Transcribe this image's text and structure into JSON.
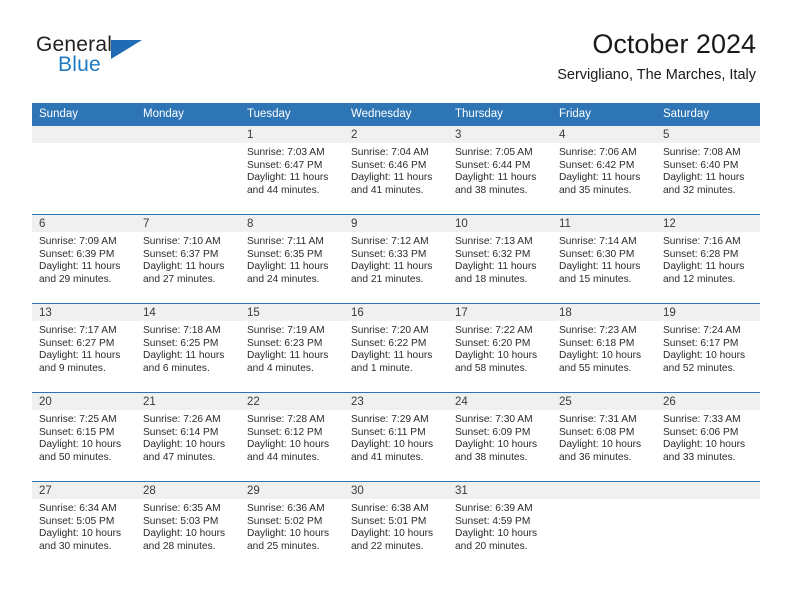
{
  "brand": {
    "name_part1": "General",
    "name_part2": "Blue",
    "logo_icon": "triangle-flag-icon"
  },
  "header": {
    "month_title": "October 2024",
    "location": "Servigliano, The Marches, Italy"
  },
  "theme": {
    "header_blue": "#2e75b6",
    "daynum_band": "#f0f0f0",
    "brand_blue": "#1f7ac4",
    "text": "#2b2b2b"
  },
  "weekday_headers": [
    "Sunday",
    "Monday",
    "Tuesday",
    "Wednesday",
    "Thursday",
    "Friday",
    "Saturday"
  ],
  "labels": {
    "sunrise_prefix": "Sunrise:",
    "sunset_prefix": "Sunset:",
    "daylight_prefix": "Daylight:"
  },
  "weeks": [
    [
      {
        "day": "",
        "empty": true,
        "sunrise": "",
        "sunset": "",
        "daylight_line1": "",
        "daylight_line2": ""
      },
      {
        "day": "",
        "empty": true,
        "sunrise": "",
        "sunset": "",
        "daylight_line1": "",
        "daylight_line2": ""
      },
      {
        "day": "1",
        "empty": false,
        "sunrise": "Sunrise: 7:03 AM",
        "sunset": "Sunset: 6:47 PM",
        "daylight_line1": "Daylight: 11 hours",
        "daylight_line2": "and 44 minutes."
      },
      {
        "day": "2",
        "empty": false,
        "sunrise": "Sunrise: 7:04 AM",
        "sunset": "Sunset: 6:46 PM",
        "daylight_line1": "Daylight: 11 hours",
        "daylight_line2": "and 41 minutes."
      },
      {
        "day": "3",
        "empty": false,
        "sunrise": "Sunrise: 7:05 AM",
        "sunset": "Sunset: 6:44 PM",
        "daylight_line1": "Daylight: 11 hours",
        "daylight_line2": "and 38 minutes."
      },
      {
        "day": "4",
        "empty": false,
        "sunrise": "Sunrise: 7:06 AM",
        "sunset": "Sunset: 6:42 PM",
        "daylight_line1": "Daylight: 11 hours",
        "daylight_line2": "and 35 minutes."
      },
      {
        "day": "5",
        "empty": false,
        "sunrise": "Sunrise: 7:08 AM",
        "sunset": "Sunset: 6:40 PM",
        "daylight_line1": "Daylight: 11 hours",
        "daylight_line2": "and 32 minutes."
      }
    ],
    [
      {
        "day": "6",
        "empty": false,
        "sunrise": "Sunrise: 7:09 AM",
        "sunset": "Sunset: 6:39 PM",
        "daylight_line1": "Daylight: 11 hours",
        "daylight_line2": "and 29 minutes."
      },
      {
        "day": "7",
        "empty": false,
        "sunrise": "Sunrise: 7:10 AM",
        "sunset": "Sunset: 6:37 PM",
        "daylight_line1": "Daylight: 11 hours",
        "daylight_line2": "and 27 minutes."
      },
      {
        "day": "8",
        "empty": false,
        "sunrise": "Sunrise: 7:11 AM",
        "sunset": "Sunset: 6:35 PM",
        "daylight_line1": "Daylight: 11 hours",
        "daylight_line2": "and 24 minutes."
      },
      {
        "day": "9",
        "empty": false,
        "sunrise": "Sunrise: 7:12 AM",
        "sunset": "Sunset: 6:33 PM",
        "daylight_line1": "Daylight: 11 hours",
        "daylight_line2": "and 21 minutes."
      },
      {
        "day": "10",
        "empty": false,
        "sunrise": "Sunrise: 7:13 AM",
        "sunset": "Sunset: 6:32 PM",
        "daylight_line1": "Daylight: 11 hours",
        "daylight_line2": "and 18 minutes."
      },
      {
        "day": "11",
        "empty": false,
        "sunrise": "Sunrise: 7:14 AM",
        "sunset": "Sunset: 6:30 PM",
        "daylight_line1": "Daylight: 11 hours",
        "daylight_line2": "and 15 minutes."
      },
      {
        "day": "12",
        "empty": false,
        "sunrise": "Sunrise: 7:16 AM",
        "sunset": "Sunset: 6:28 PM",
        "daylight_line1": "Daylight: 11 hours",
        "daylight_line2": "and 12 minutes."
      }
    ],
    [
      {
        "day": "13",
        "empty": false,
        "sunrise": "Sunrise: 7:17 AM",
        "sunset": "Sunset: 6:27 PM",
        "daylight_line1": "Daylight: 11 hours",
        "daylight_line2": "and 9 minutes."
      },
      {
        "day": "14",
        "empty": false,
        "sunrise": "Sunrise: 7:18 AM",
        "sunset": "Sunset: 6:25 PM",
        "daylight_line1": "Daylight: 11 hours",
        "daylight_line2": "and 6 minutes."
      },
      {
        "day": "15",
        "empty": false,
        "sunrise": "Sunrise: 7:19 AM",
        "sunset": "Sunset: 6:23 PM",
        "daylight_line1": "Daylight: 11 hours",
        "daylight_line2": "and 4 minutes."
      },
      {
        "day": "16",
        "empty": false,
        "sunrise": "Sunrise: 7:20 AM",
        "sunset": "Sunset: 6:22 PM",
        "daylight_line1": "Daylight: 11 hours",
        "daylight_line2": "and 1 minute."
      },
      {
        "day": "17",
        "empty": false,
        "sunrise": "Sunrise: 7:22 AM",
        "sunset": "Sunset: 6:20 PM",
        "daylight_line1": "Daylight: 10 hours",
        "daylight_line2": "and 58 minutes."
      },
      {
        "day": "18",
        "empty": false,
        "sunrise": "Sunrise: 7:23 AM",
        "sunset": "Sunset: 6:18 PM",
        "daylight_line1": "Daylight: 10 hours",
        "daylight_line2": "and 55 minutes."
      },
      {
        "day": "19",
        "empty": false,
        "sunrise": "Sunrise: 7:24 AM",
        "sunset": "Sunset: 6:17 PM",
        "daylight_line1": "Daylight: 10 hours",
        "daylight_line2": "and 52 minutes."
      }
    ],
    [
      {
        "day": "20",
        "empty": false,
        "sunrise": "Sunrise: 7:25 AM",
        "sunset": "Sunset: 6:15 PM",
        "daylight_line1": "Daylight: 10 hours",
        "daylight_line2": "and 50 minutes."
      },
      {
        "day": "21",
        "empty": false,
        "sunrise": "Sunrise: 7:26 AM",
        "sunset": "Sunset: 6:14 PM",
        "daylight_line1": "Daylight: 10 hours",
        "daylight_line2": "and 47 minutes."
      },
      {
        "day": "22",
        "empty": false,
        "sunrise": "Sunrise: 7:28 AM",
        "sunset": "Sunset: 6:12 PM",
        "daylight_line1": "Daylight: 10 hours",
        "daylight_line2": "and 44 minutes."
      },
      {
        "day": "23",
        "empty": false,
        "sunrise": "Sunrise: 7:29 AM",
        "sunset": "Sunset: 6:11 PM",
        "daylight_line1": "Daylight: 10 hours",
        "daylight_line2": "and 41 minutes."
      },
      {
        "day": "24",
        "empty": false,
        "sunrise": "Sunrise: 7:30 AM",
        "sunset": "Sunset: 6:09 PM",
        "daylight_line1": "Daylight: 10 hours",
        "daylight_line2": "and 38 minutes."
      },
      {
        "day": "25",
        "empty": false,
        "sunrise": "Sunrise: 7:31 AM",
        "sunset": "Sunset: 6:08 PM",
        "daylight_line1": "Daylight: 10 hours",
        "daylight_line2": "and 36 minutes."
      },
      {
        "day": "26",
        "empty": false,
        "sunrise": "Sunrise: 7:33 AM",
        "sunset": "Sunset: 6:06 PM",
        "daylight_line1": "Daylight: 10 hours",
        "daylight_line2": "and 33 minutes."
      }
    ],
    [
      {
        "day": "27",
        "empty": false,
        "sunrise": "Sunrise: 6:34 AM",
        "sunset": "Sunset: 5:05 PM",
        "daylight_line1": "Daylight: 10 hours",
        "daylight_line2": "and 30 minutes."
      },
      {
        "day": "28",
        "empty": false,
        "sunrise": "Sunrise: 6:35 AM",
        "sunset": "Sunset: 5:03 PM",
        "daylight_line1": "Daylight: 10 hours",
        "daylight_line2": "and 28 minutes."
      },
      {
        "day": "29",
        "empty": false,
        "sunrise": "Sunrise: 6:36 AM",
        "sunset": "Sunset: 5:02 PM",
        "daylight_line1": "Daylight: 10 hours",
        "daylight_line2": "and 25 minutes."
      },
      {
        "day": "30",
        "empty": false,
        "sunrise": "Sunrise: 6:38 AM",
        "sunset": "Sunset: 5:01 PM",
        "daylight_line1": "Daylight: 10 hours",
        "daylight_line2": "and 22 minutes."
      },
      {
        "day": "31",
        "empty": false,
        "sunrise": "Sunrise: 6:39 AM",
        "sunset": "Sunset: 4:59 PM",
        "daylight_line1": "Daylight: 10 hours",
        "daylight_line2": "and 20 minutes."
      },
      {
        "day": "",
        "empty": true,
        "sunrise": "",
        "sunset": "",
        "daylight_line1": "",
        "daylight_line2": ""
      },
      {
        "day": "",
        "empty": true,
        "sunrise": "",
        "sunset": "",
        "daylight_line1": "",
        "daylight_line2": ""
      }
    ]
  ]
}
